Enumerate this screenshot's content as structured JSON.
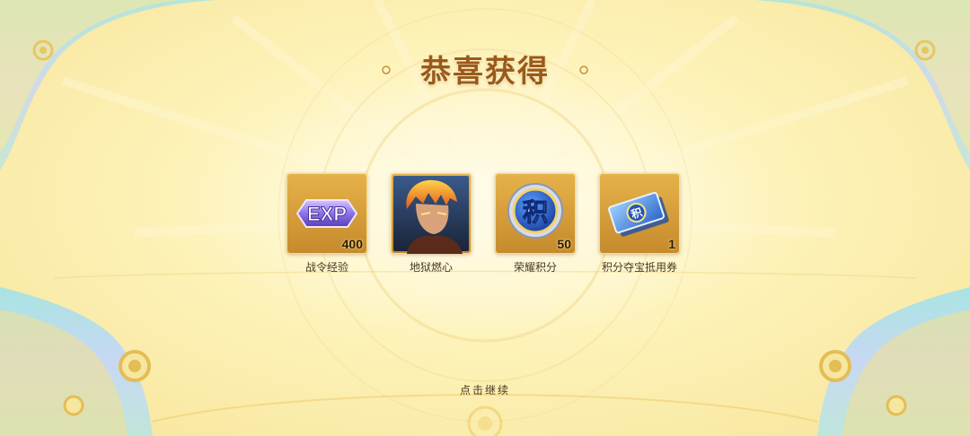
{
  "title": "恭喜获得",
  "rewards": [
    {
      "icon": "exp-icon",
      "label": "战令经验",
      "count": "400"
    },
    {
      "icon": "hero-portrait-icon",
      "label": "地狱燃心",
      "count": ""
    },
    {
      "icon": "honor-points-coin-icon",
      "label": "荣耀积分",
      "count": "50"
    },
    {
      "icon": "points-voucher-icon",
      "label": "积分夺宝抵用券",
      "count": "1"
    }
  ],
  "exp_badge_text": "EXP",
  "coin_char": "积",
  "voucher_char": "积",
  "continue_text": "点击继续",
  "colors": {
    "title": "#9a5a1c",
    "frame_gold": "#d89e3a",
    "background": "#fdf2b8",
    "frame_teal": "#8fd8d8"
  }
}
